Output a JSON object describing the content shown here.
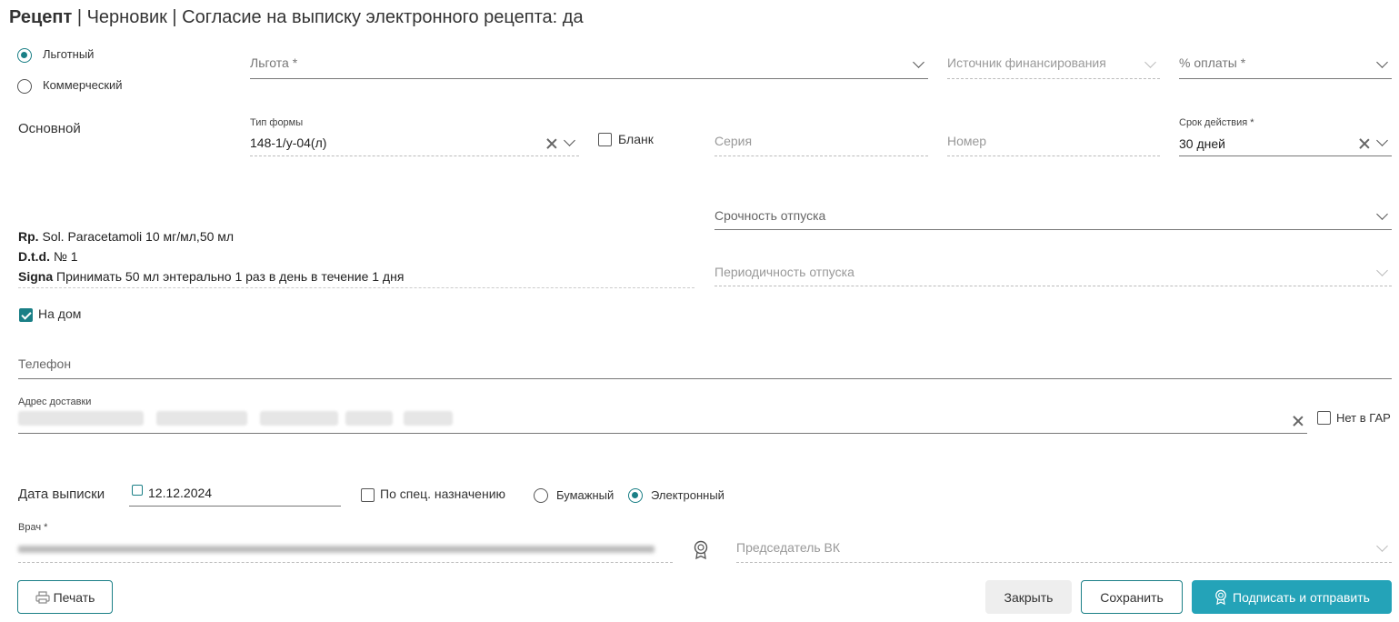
{
  "header": {
    "title_bold": "Рецепт",
    "title_rest": " | Черновик | Согласие на выписку электронного рецепта: да"
  },
  "type_radio": {
    "preferential": "Льготный",
    "commercial": "Коммерческий"
  },
  "benefit": {
    "placeholder": "Льгота *"
  },
  "funding_source": {
    "placeholder": "Источник финансирования"
  },
  "payment_percent": {
    "placeholder": "% оплаты *"
  },
  "section_main": "Основной",
  "form_type": {
    "label": "Тип формы",
    "value": "148-1/у-04(л)"
  },
  "blank": {
    "label": "Бланк"
  },
  "series": {
    "placeholder": "Серия"
  },
  "number": {
    "placeholder": "Номер"
  },
  "validity": {
    "label": "Срок действия *",
    "value": "30 дней"
  },
  "urgency": {
    "placeholder": "Срочность отпуска"
  },
  "periodicity": {
    "placeholder": "Периодичность отпуска"
  },
  "prescription": {
    "rp_label": "Rp.",
    "rp_text": " Sol. Paracetamoli 10 мг/мл,50 мл",
    "dtd_label": "D.t.d.",
    "dtd_text": " № 1",
    "signa_label": "Signa",
    "signa_text": " Принимать 50 мл энтерально 1 раз в день в течение 1 дня"
  },
  "home_delivery": {
    "label": "На дом"
  },
  "phone": {
    "placeholder": "Телефон"
  },
  "delivery_address": {
    "label": "Адрес доставки"
  },
  "no_gar": {
    "label": "Нет в ГАР"
  },
  "issue_date": {
    "label": "Дата выписки",
    "value": "12.12.2024"
  },
  "special_purpose": {
    "label": "По спец. назначению"
  },
  "format_radio": {
    "paper": "Бумажный",
    "electronic": "Электронный"
  },
  "doctor": {
    "label": "Врач *"
  },
  "vk_chair": {
    "placeholder": "Председатель ВК"
  },
  "buttons": {
    "print": "Печать",
    "close": "Закрыть",
    "save": "Сохранить",
    "sign_send": "Подписать и отправить"
  },
  "colors": {
    "accent": "#1a7f86",
    "primary_button": "#24a3b8"
  }
}
